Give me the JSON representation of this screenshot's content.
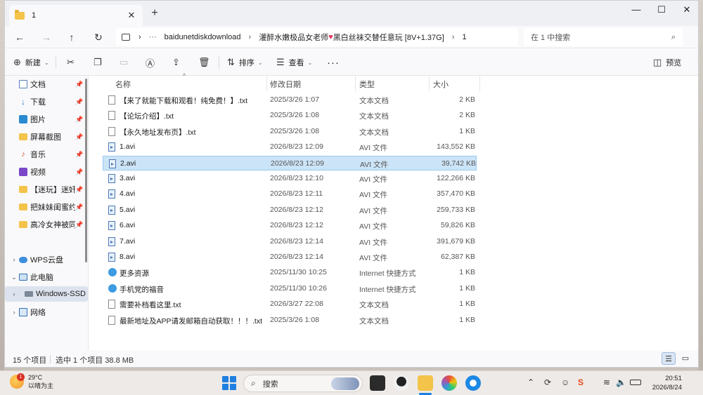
{
  "window": {
    "tab_title": "1",
    "tab_close": "✕",
    "new_tab": "+",
    "minimize": "—",
    "maximize": "☐",
    "close": "✕"
  },
  "address": {
    "more": "···",
    "segments": [
      "baidunetdiskdownload",
      "灌醉水嫩极品女老师",
      "黑白丝袜交替任意玩 [8V+1.37G]",
      "1"
    ],
    "heart": "♥",
    "sep": "›",
    "search_placeholder": "在 1 中搜索"
  },
  "toolbar": {
    "new_label": "新建",
    "sort_label": "排序",
    "view_label": "查看",
    "more": "···",
    "preview_label": "预览"
  },
  "sidebar": {
    "quick": [
      {
        "label": "文档",
        "icon": "document-icon"
      },
      {
        "label": "下载",
        "icon": "download-icon"
      },
      {
        "label": "图片",
        "icon": "pictures-icon"
      },
      {
        "label": "屏幕截图",
        "icon": "folder-icon"
      },
      {
        "label": "音乐",
        "icon": "music-icon"
      },
      {
        "label": "视频",
        "icon": "videos-icon"
      },
      {
        "label": "【迷玩】迷奸",
        "icon": "folder-icon"
      },
      {
        "label": "把妹妹闺蜜约",
        "icon": "folder-icon"
      },
      {
        "label": "高冷女神被同",
        "icon": "folder-icon"
      }
    ],
    "wps": "WPS云盘",
    "this_pc": "此电脑",
    "drive": "Windows-SSD",
    "network": "网络"
  },
  "columns": {
    "name": "名称",
    "date": "修改日期",
    "type": "类型",
    "size": "大小"
  },
  "files": [
    {
      "name": "【来了就能下载和观看！纯免费！】.txt",
      "date": "2025/3/26 1:07",
      "type": "文本文档",
      "size": "2 KB",
      "kind": "txt"
    },
    {
      "name": "【论坛介绍】.txt",
      "date": "2025/3/26 1:08",
      "type": "文本文档",
      "size": "2 KB",
      "kind": "txt"
    },
    {
      "name": "【永久地址发布页】.txt",
      "date": "2025/3/26 1:08",
      "type": "文本文档",
      "size": "1 KB",
      "kind": "txt"
    },
    {
      "name": "1.avi",
      "date": "2026/8/23 12:09",
      "type": "AVI 文件",
      "size": "143,552 KB",
      "kind": "avi"
    },
    {
      "name": "2.avi",
      "date": "2026/8/23 12:09",
      "type": "AVI 文件",
      "size": "39,742 KB",
      "kind": "avi"
    },
    {
      "name": "3.avi",
      "date": "2026/8/23 12:10",
      "type": "AVI 文件",
      "size": "122,266 KB",
      "kind": "avi"
    },
    {
      "name": "4.avi",
      "date": "2026/8/23 12:11",
      "type": "AVI 文件",
      "size": "357,470 KB",
      "kind": "avi"
    },
    {
      "name": "5.avi",
      "date": "2026/8/23 12:12",
      "type": "AVI 文件",
      "size": "259,733 KB",
      "kind": "avi"
    },
    {
      "name": "6.avi",
      "date": "2026/8/23 12:12",
      "type": "AVI 文件",
      "size": "59,826 KB",
      "kind": "avi"
    },
    {
      "name": "7.avi",
      "date": "2026/8/23 12:14",
      "type": "AVI 文件",
      "size": "391,679 KB",
      "kind": "avi"
    },
    {
      "name": "8.avi",
      "date": "2026/8/23 12:14",
      "type": "AVI 文件",
      "size": "62,387 KB",
      "kind": "avi"
    },
    {
      "name": "更多资源",
      "date": "2025/11/30 10:25",
      "type": "Internet 快捷方式",
      "size": "1 KB",
      "kind": "url"
    },
    {
      "name": "手机党的福音",
      "date": "2025/11/30 10:26",
      "type": "Internet 快捷方式",
      "size": "1 KB",
      "kind": "url"
    },
    {
      "name": "需要补档看这里.txt",
      "date": "2026/3/27 22:08",
      "type": "文本文档",
      "size": "1 KB",
      "kind": "txt"
    },
    {
      "name": "最新地址及APP请发邮箱自动获取！！！.txt",
      "date": "2025/3/26 1:08",
      "type": "文本文档",
      "size": "1 KB",
      "kind": "txt"
    }
  ],
  "selected_index": 4,
  "status": {
    "count": "15 个项目",
    "selection": "选中 1 个项目  38.8 MB"
  },
  "taskbar": {
    "temperature": "29°C",
    "weather": "以晴为主",
    "weather_badge": "1",
    "search_label": "搜索",
    "ime": "S",
    "time": "20:51",
    "date": "2026/8/24"
  },
  "colors": {
    "accent": "#1f7fe0",
    "selection_bg": "#cce4f7",
    "selection_border": "#99c9ef",
    "folder": "#f3c34a"
  }
}
